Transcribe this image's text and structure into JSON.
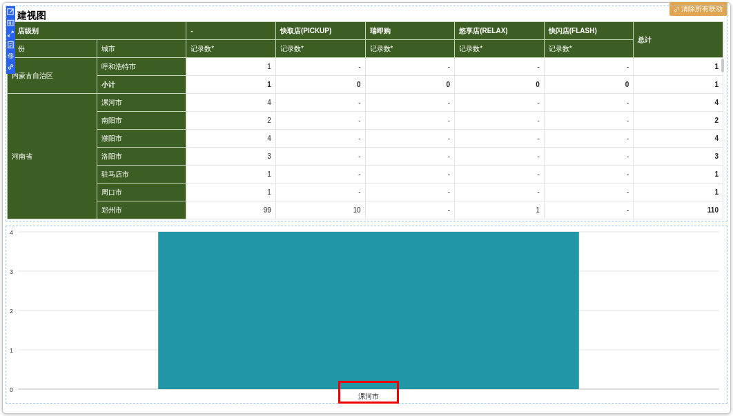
{
  "title": "建视图",
  "clear_button": {
    "label": "清除所有联动"
  },
  "table": {
    "columns_top": [
      "店级别",
      "-",
      "快取店(PICKUP)",
      "瑞即购",
      "悠享店(RELAX)",
      "快闪店(FLASH)"
    ],
    "total_header": "总计",
    "columns_sub": [
      "份",
      "城市",
      "记录数*",
      "记录数*",
      "记录数*",
      "记录数*",
      "记录数*"
    ],
    "groups": [
      {
        "province": "内蒙古自治区",
        "rows": [
          {
            "city": "呼和浩特市",
            "kind": "detail",
            "cells": [
              "1",
              "-",
              "-",
              "-",
              "-"
            ],
            "total": "1"
          },
          {
            "city": "小计",
            "kind": "subtotal",
            "cells": [
              "1",
              "0",
              "0",
              "0",
              "0"
            ],
            "total": "1"
          }
        ]
      },
      {
        "province": "河南省",
        "rows": [
          {
            "city": "漯河市",
            "kind": "detail",
            "cells": [
              "4",
              "-",
              "-",
              "-",
              "-"
            ],
            "total": "4"
          },
          {
            "city": "南阳市",
            "kind": "detail",
            "cells": [
              "2",
              "-",
              "-",
              "-",
              "-"
            ],
            "total": "2"
          },
          {
            "city": "濮阳市",
            "kind": "detail",
            "cells": [
              "4",
              "-",
              "-",
              "-",
              "-"
            ],
            "total": "4"
          },
          {
            "city": "洛阳市",
            "kind": "detail",
            "cells": [
              "3",
              "-",
              "-",
              "-",
              "-"
            ],
            "total": "3"
          },
          {
            "city": "驻马店市",
            "kind": "detail",
            "cells": [
              "1",
              "-",
              "-",
              "-",
              "-"
            ],
            "total": "1"
          },
          {
            "city": "周口市",
            "kind": "detail",
            "cells": [
              "1",
              "-",
              "-",
              "-",
              "-"
            ],
            "total": "1"
          },
          {
            "city": "郑州市",
            "kind": "detail",
            "cells": [
              "99",
              "10",
              "-",
              "1",
              "-"
            ],
            "total": "110"
          }
        ]
      }
    ]
  },
  "chart": {
    "chart_data": {
      "type": "bar",
      "categories": [
        "漯河市"
      ],
      "series": [
        {
          "color": "#2196a4",
          "values": [
            4
          ]
        }
      ],
      "ylim": [
        0,
        4
      ],
      "yticks": [
        0,
        1,
        2,
        3,
        4
      ],
      "grid": true
    },
    "label_highlight": {
      "color": "#ee0000"
    }
  }
}
